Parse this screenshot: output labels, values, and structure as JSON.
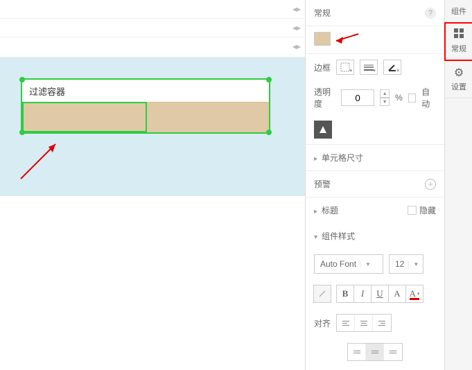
{
  "canvas": {
    "filter_label": "过滤容器"
  },
  "panel": {
    "header": "常规",
    "border_label": "边框",
    "opacity_label": "透明度",
    "opacity_value": "0",
    "opacity_unit": "%",
    "auto_label": "自动",
    "cell_size_label": "单元格尺寸",
    "alert_label": "预警",
    "title_label": "标题",
    "hide_label": "隐藏",
    "style_label": "组件样式",
    "font_family": "Auto Font",
    "font_size": "12",
    "align_label": "对齐",
    "bold": "B",
    "italic": "I",
    "underline": "U",
    "strike": "A",
    "color": "A"
  },
  "tabs": {
    "components": "组件",
    "general": "常规",
    "settings": "设置"
  }
}
